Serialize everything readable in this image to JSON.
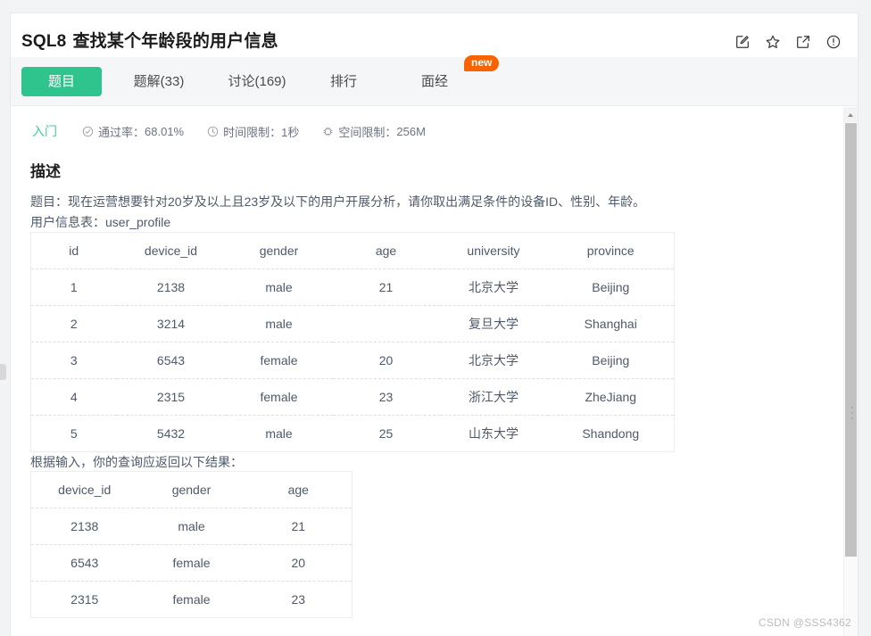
{
  "header": {
    "problem_code": "SQL8",
    "problem_title": "查找某个年龄段的用户信息",
    "actions": [
      {
        "name": "note-edit-icon",
        "label": "笔记"
      },
      {
        "name": "star-icon",
        "label": "收藏"
      },
      {
        "name": "share-external-icon",
        "label": "分享"
      },
      {
        "name": "report-warning-icon",
        "label": "反馈"
      }
    ]
  },
  "tabs": [
    {
      "label": "题目",
      "active": true,
      "badge": ""
    },
    {
      "label": "题解(33)",
      "active": false,
      "badge": ""
    },
    {
      "label": "讨论(169)",
      "active": false,
      "badge": ""
    },
    {
      "label": "排行",
      "active": false,
      "badge": ""
    },
    {
      "label": "面经",
      "active": false,
      "badge": "new"
    }
  ],
  "meta": {
    "level": "入门",
    "items": [
      {
        "icon": "check-circle-icon",
        "label": "通过率：",
        "value": "68.01%"
      },
      {
        "icon": "clock-icon",
        "label": "时间限制：",
        "value": "1秒"
      },
      {
        "icon": "memory-chip-icon",
        "label": "空间限制：",
        "value": "256M"
      }
    ]
  },
  "description": {
    "section_title": "描述",
    "line1": "题目：现在运营想要针对20岁及以上且23岁及以下的用户开展分析，请你取出满足条件的设备ID、性别、年龄。",
    "line2": "用户信息表：user_profile",
    "line3": "根据输入，你的查询应返回以下结果："
  },
  "table_input": {
    "columns": [
      "id",
      "device_id",
      "gender",
      "age",
      "university",
      "province"
    ],
    "rows": [
      [
        "1",
        "2138",
        "male",
        "21",
        "北京大学",
        "Beijing"
      ],
      [
        "2",
        "3214",
        "male",
        "",
        "复旦大学",
        "Shanghai"
      ],
      [
        "3",
        "6543",
        "female",
        "20",
        "北京大学",
        "Beijing"
      ],
      [
        "4",
        "2315",
        "female",
        "23",
        "浙江大学",
        "ZheJiang"
      ],
      [
        "5",
        "5432",
        "male",
        "25",
        "山东大学",
        "Shandong"
      ]
    ]
  },
  "table_output": {
    "columns": [
      "device_id",
      "gender",
      "age"
    ],
    "rows": [
      [
        "2138",
        "male",
        "21"
      ],
      [
        "6543",
        "female",
        "20"
      ],
      [
        "2315",
        "female",
        "23"
      ]
    ]
  },
  "watermark": "CSDN @SSS4362",
  "colors": {
    "accent_green": "#2fc48d",
    "level_green": "#41cf8e",
    "badge_orange": "#fa6400",
    "text_body": "#4e5969",
    "tabbar_bg": "#f5f6f7"
  }
}
